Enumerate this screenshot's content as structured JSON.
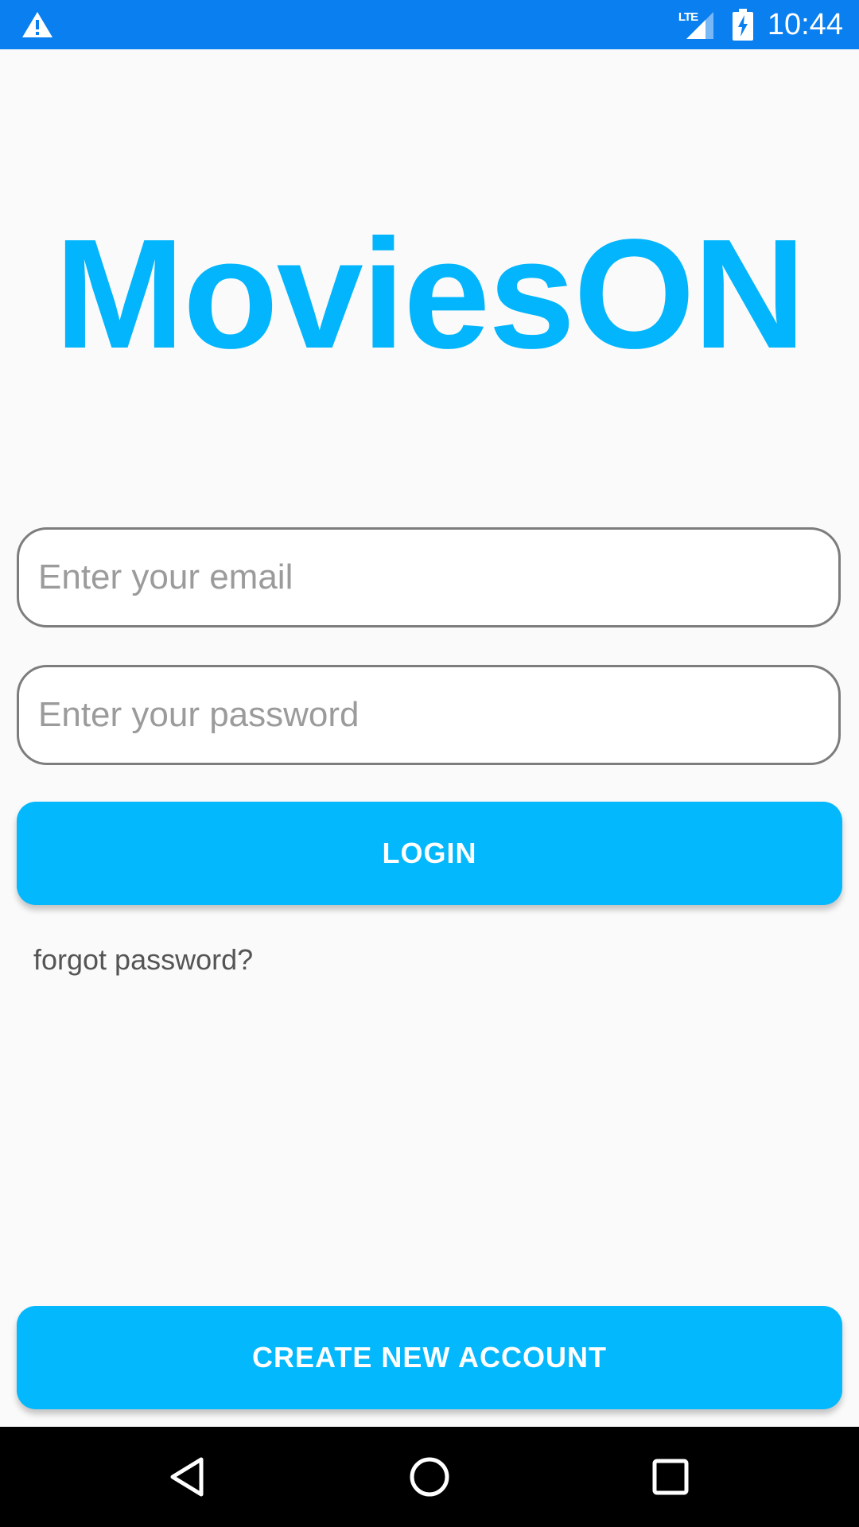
{
  "status_bar": {
    "time": "10:44",
    "network": "LTE",
    "icons": [
      "warning-icon",
      "lte-signal-icon",
      "battery-charging-icon"
    ],
    "color": "#0a7ff0"
  },
  "app": {
    "title": "MoviesON",
    "accent_color": "#03b5fc"
  },
  "login_form": {
    "email_placeholder": "Enter your email",
    "email_value": "",
    "password_placeholder": "Enter your password",
    "password_value": "",
    "login_label": "LOGIN",
    "forgot_label": "forgot password?"
  },
  "footer": {
    "create_account_label": "CREATE NEW ACCOUNT"
  },
  "nav_bar": {
    "icons": [
      "back-icon",
      "home-icon",
      "recents-icon"
    ]
  }
}
